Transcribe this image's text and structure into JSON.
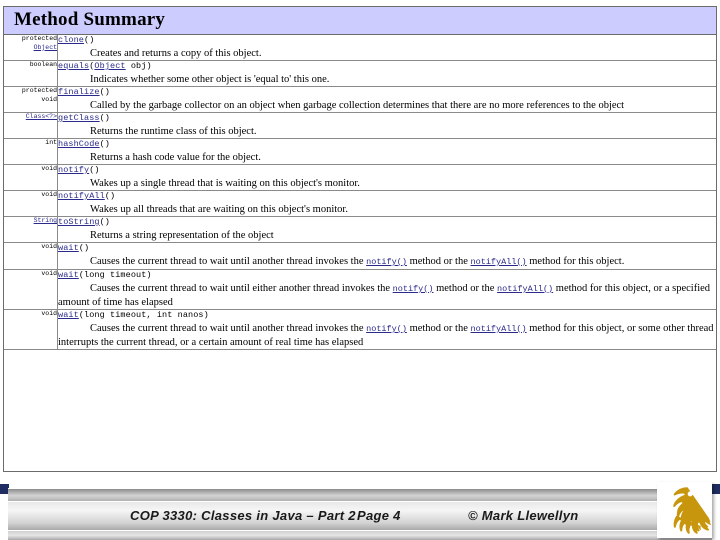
{
  "slide": {
    "javadoc": {
      "header_title": "Method Summary",
      "rows": [
        {
          "type_modifier": "protected",
          "type_name": "Object",
          "type_link": true,
          "method_name": "clone",
          "signature_args": "()",
          "description": "Creates and returns a copy of this object."
        },
        {
          "type_modifier": "",
          "type_name": "boolean",
          "type_link": false,
          "method_name": "equals",
          "signature_args": "(Object obj)",
          "arg_type_link": "Object",
          "arg_name": "obj",
          "description": "Indicates whether some other object is 'equal to' this one."
        },
        {
          "type_modifier": "protected",
          "type_name": "void",
          "type_link": false,
          "method_name": "finalize",
          "signature_args": "()",
          "description": "Called by the garbage collector on an object when garbage collection determines that there are no more references to the object"
        },
        {
          "type_modifier": "",
          "type_name": "Class<?>",
          "type_link": true,
          "method_name": "getClass",
          "signature_args": "()",
          "description": "Returns the runtime class of this object."
        },
        {
          "type_modifier": "",
          "type_name": "int",
          "type_link": false,
          "method_name": "hashCode",
          "signature_args": "()",
          "description": "Returns a hash code value for the object."
        },
        {
          "type_modifier": "",
          "type_name": "void",
          "type_link": false,
          "method_name": "notify",
          "signature_args": "()",
          "description": "Wakes up a single thread that is waiting on this object's monitor."
        },
        {
          "type_modifier": "",
          "type_name": "void",
          "type_link": false,
          "method_name": "notifyAll",
          "signature_args": "()",
          "description": "Wakes up all threads that are waiting on this object's monitor."
        },
        {
          "type_modifier": "",
          "type_name": "String",
          "type_link": true,
          "method_name": "toString",
          "signature_args": "()",
          "description": "Returns a string representation of the object"
        },
        {
          "type_modifier": "",
          "type_name": "void",
          "type_link": false,
          "method_name": "wait",
          "signature_args": "()",
          "desc_part1": "Causes the current thread to wait until another thread invokes the ",
          "desc_link1": "notify()",
          "desc_part2": " method or the ",
          "desc_link2": "notifyAll()",
          "desc_part3": " method for this object."
        },
        {
          "type_modifier": "",
          "type_name": "void",
          "type_link": false,
          "method_name": "wait",
          "signature_args": "(long timeout)",
          "desc_part1": "Causes the current thread to wait until either another thread invokes the ",
          "desc_link1": "notify()",
          "desc_part2": " method or the ",
          "desc_link2": "notifyAll()",
          "desc_part3": " method for this object, or a specified amount of time has elapsed"
        },
        {
          "type_modifier": "",
          "type_name": "void",
          "type_link": false,
          "method_name": "wait",
          "signature_args": "(long timeout, int nanos)",
          "desc_part1": "Causes the current thread to wait until another thread invokes the ",
          "desc_link1": "notify()",
          "desc_part2": " method or the ",
          "desc_link2": "notifyAll()",
          "desc_part3": " method for this object, or some other thread interrupts the current thread, or a certain amount of real time has elapsed"
        }
      ]
    },
    "footer": {
      "course": "COP 3330:  Classes in Java – Part 2",
      "page": "Page 4",
      "copyright": "© Mark Llewellyn",
      "logo": "pegasus-logo"
    },
    "colors": {
      "header_background": "#ccccff",
      "link": "#2a2a8c",
      "table_border": "#8a8a8a",
      "logo_gold": "#c8960c",
      "footer_navy": "#1f2d62"
    }
  }
}
